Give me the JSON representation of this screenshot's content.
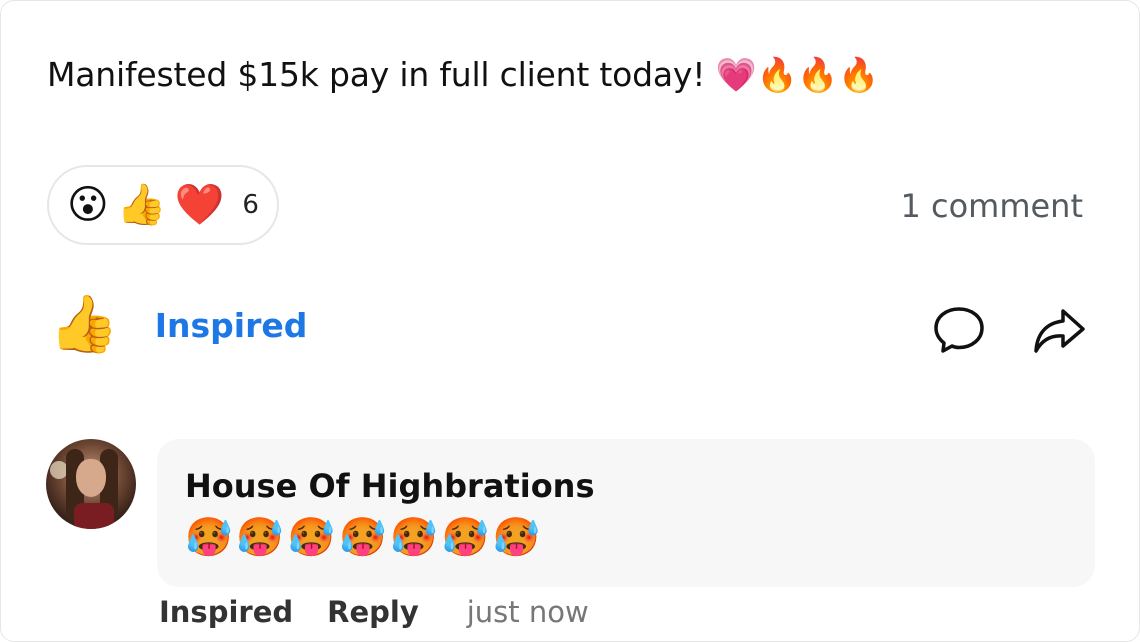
{
  "post": {
    "text": "Manifested $15k pay in full client today! 💗🔥🔥🔥"
  },
  "reactions": {
    "emojis": [
      "😮",
      "👍",
      "❤️"
    ],
    "count": "6",
    "comment_count": "1 comment"
  },
  "actions": {
    "thumb_emoji": "👍",
    "inspired_label": "Inspired",
    "comment_icon": "comment-icon",
    "share_icon": "share-icon"
  },
  "comment": {
    "author": "House Of Highbrations",
    "text": "🥵🥵🥵🥵🥵🥵🥵",
    "actions": {
      "inspired_label": "Inspired",
      "reply_label": "Reply",
      "timestamp": "just now"
    }
  },
  "colors": {
    "accent": "#1d78e6",
    "muted": "#555a60",
    "bubble_bg": "#f7f7f7"
  }
}
